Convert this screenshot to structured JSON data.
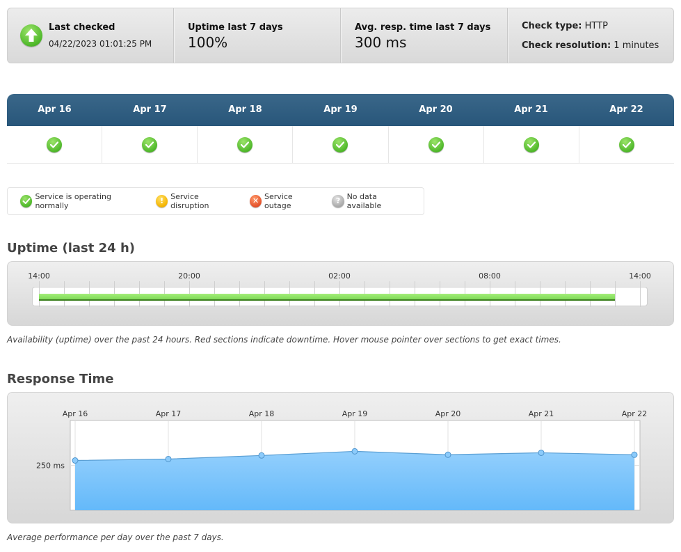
{
  "summary": {
    "last_checked_label": "Last checked",
    "last_checked_value": "04/22/2023 01:01:25 PM",
    "uptime_label": "Uptime last 7 days",
    "uptime_value": "100%",
    "avg_resp_label": "Avg. resp. time last 7 days",
    "avg_resp_value": "300 ms",
    "check_type_label": "Check type:",
    "check_type_value": "HTTP",
    "check_resolution_label": "Check resolution:",
    "check_resolution_value": "1 minutes",
    "status_icon": "arrow-up-icon"
  },
  "calendar": {
    "days": [
      {
        "label": "Apr 16",
        "status": "ok"
      },
      {
        "label": "Apr 17",
        "status": "ok"
      },
      {
        "label": "Apr 18",
        "status": "ok"
      },
      {
        "label": "Apr 19",
        "status": "ok"
      },
      {
        "label": "Apr 20",
        "status": "ok"
      },
      {
        "label": "Apr 21",
        "status": "ok"
      },
      {
        "label": "Apr 22",
        "status": "ok"
      }
    ]
  },
  "legend": {
    "items": [
      {
        "label": "Service is operating normally",
        "icon": "check-icon",
        "color": "#4fb82a"
      },
      {
        "label": "Service disruption",
        "icon": "exclamation-icon",
        "color": "#f4b400"
      },
      {
        "label": "Service outage",
        "icon": "x-icon",
        "color": "#e4512a"
      },
      {
        "label": "No data available",
        "icon": "question-icon",
        "color": "#a9a9a9"
      }
    ]
  },
  "uptime": {
    "title": "Uptime (last 24 h)",
    "tick_labels": [
      "14:00",
      "20:00",
      "02:00",
      "08:00",
      "14:00"
    ],
    "up_color": "#7ed957",
    "up_fraction_start": 0.0,
    "up_fraction_end": 0.958,
    "caption": "Availability (uptime) over the past 24 hours. Red sections indicate downtime. Hover mouse pointer over sections to get exact times."
  },
  "response": {
    "title": "Response Time",
    "caption": "Average performance per day over the past 7 days."
  },
  "chart_data": {
    "type": "area",
    "title": "Response Time",
    "categories": [
      "Apr 16",
      "Apr 17",
      "Apr 18",
      "Apr 19",
      "Apr 20",
      "Apr 21",
      "Apr 22"
    ],
    "series": [
      {
        "name": "Response time (ms)",
        "values": [
          277,
          285,
          305,
          328,
          309,
          320,
          309
        ],
        "color": "#6cbcf8"
      }
    ],
    "xlabel": "",
    "ylabel": "",
    "y_tick_labels": [
      "250 ms"
    ],
    "y_ticks": [
      250
    ],
    "ylim": [
      0,
      500
    ],
    "grid": true,
    "legend": "none"
  }
}
